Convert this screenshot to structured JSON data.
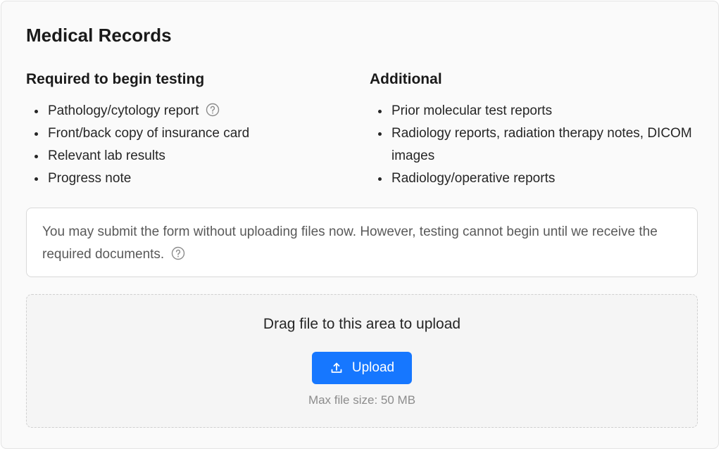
{
  "section": {
    "title": "Medical Records"
  },
  "required": {
    "heading": "Required to begin testing",
    "items": [
      "Pathology/cytology report",
      "Front/back copy of insurance card",
      "Relevant lab results",
      "Progress note"
    ]
  },
  "additional": {
    "heading": "Additional",
    "items": [
      "Prior molecular test reports",
      "Radiology reports, radiation therapy notes, DICOM images",
      "Radiology/operative reports"
    ]
  },
  "notice": {
    "text": "You may submit the form without uploading files now. However, testing cannot begin until we receive the required documents."
  },
  "upload": {
    "drag_text": "Drag file to this area to upload",
    "button_label": "Upload",
    "max_size_text": "Max file size: 50 MB"
  },
  "icons": {
    "help": "help-circle-icon",
    "upload": "upload-icon"
  },
  "colors": {
    "accent": "#1677ff",
    "background": "#fafafa",
    "muted_text": "#8c8c8c"
  }
}
